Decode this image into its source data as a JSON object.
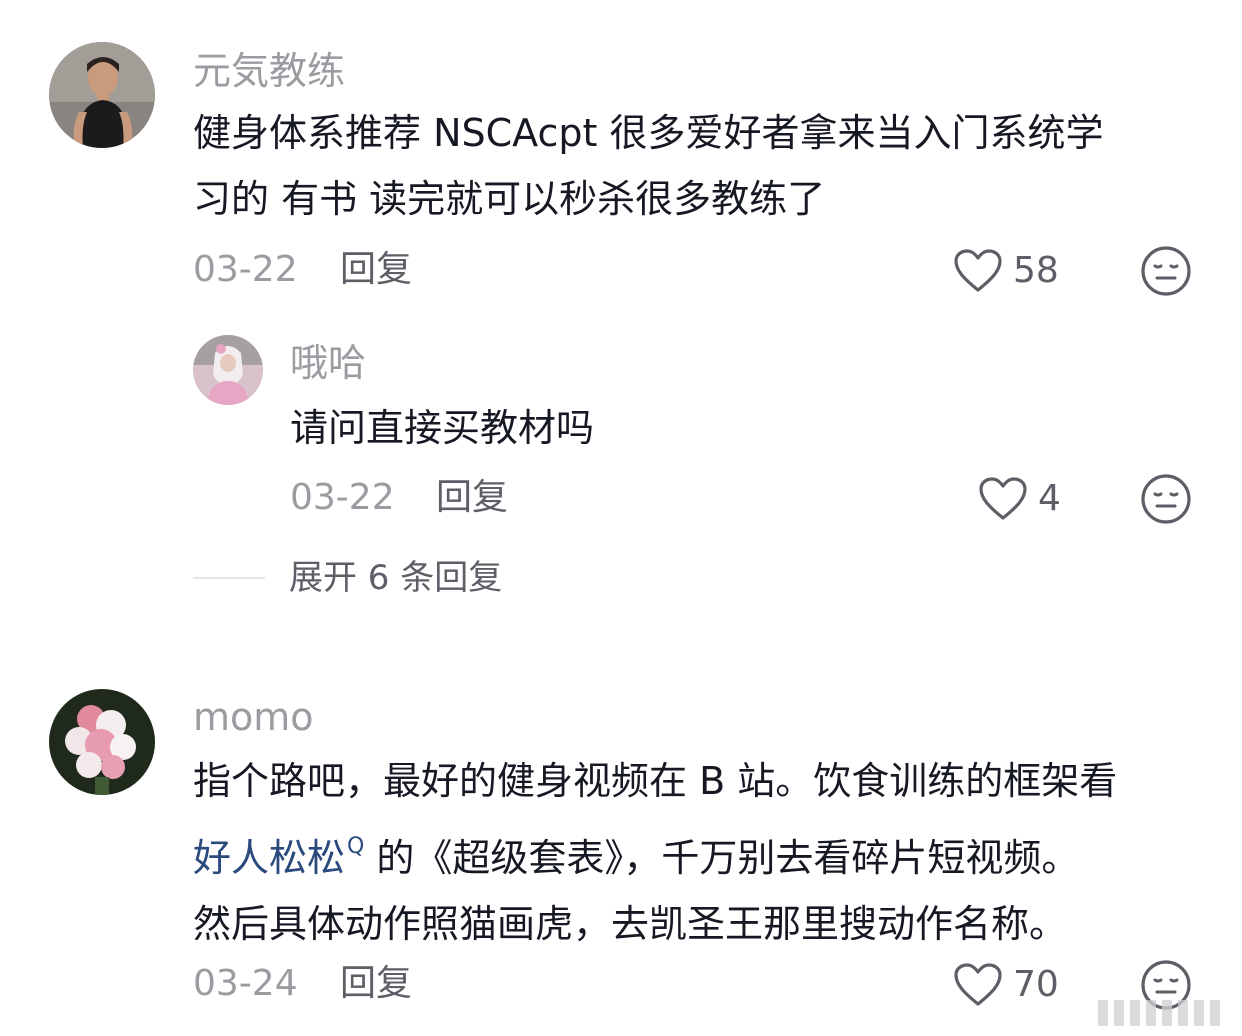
{
  "comments": [
    {
      "username": "元気教练",
      "lines": [
        "健身体系推荐 NSCAcpt 很多爱好者拿来当入门系统学",
        "习的 有书 读完就可以秒杀很多教练了"
      ],
      "date": "03-22",
      "reply_label": "回复",
      "like_count": "58",
      "reply": {
        "username": "哦哈",
        "text": "请问直接买教材吗",
        "date": "03-22",
        "reply_label": "回复",
        "like_count": "4"
      },
      "expand_label": "展开 6 条回复"
    },
    {
      "username": "momo",
      "line1": "指个路吧，最好的健身视频在 B 站。饮食训练的框架看",
      "line2_link": "好人松松",
      "line2_link_icon": "Q",
      "line2_rest": " 的《超级套表》，千万别去看碎片短视频。",
      "line3": "然后具体动作照猫画虎，去凯圣王那里搜动作名称。",
      "date": "03-24",
      "reply_label": "回复",
      "like_count": "70"
    }
  ],
  "icons": {
    "like": "heart-outline-icon",
    "dislike": "meh-face-icon",
    "search_hint": "search-icon"
  },
  "colors": {
    "text": "#161823",
    "secondary": "#9b9ca1",
    "action": "#5d5e66",
    "link": "#2b4a7d"
  }
}
